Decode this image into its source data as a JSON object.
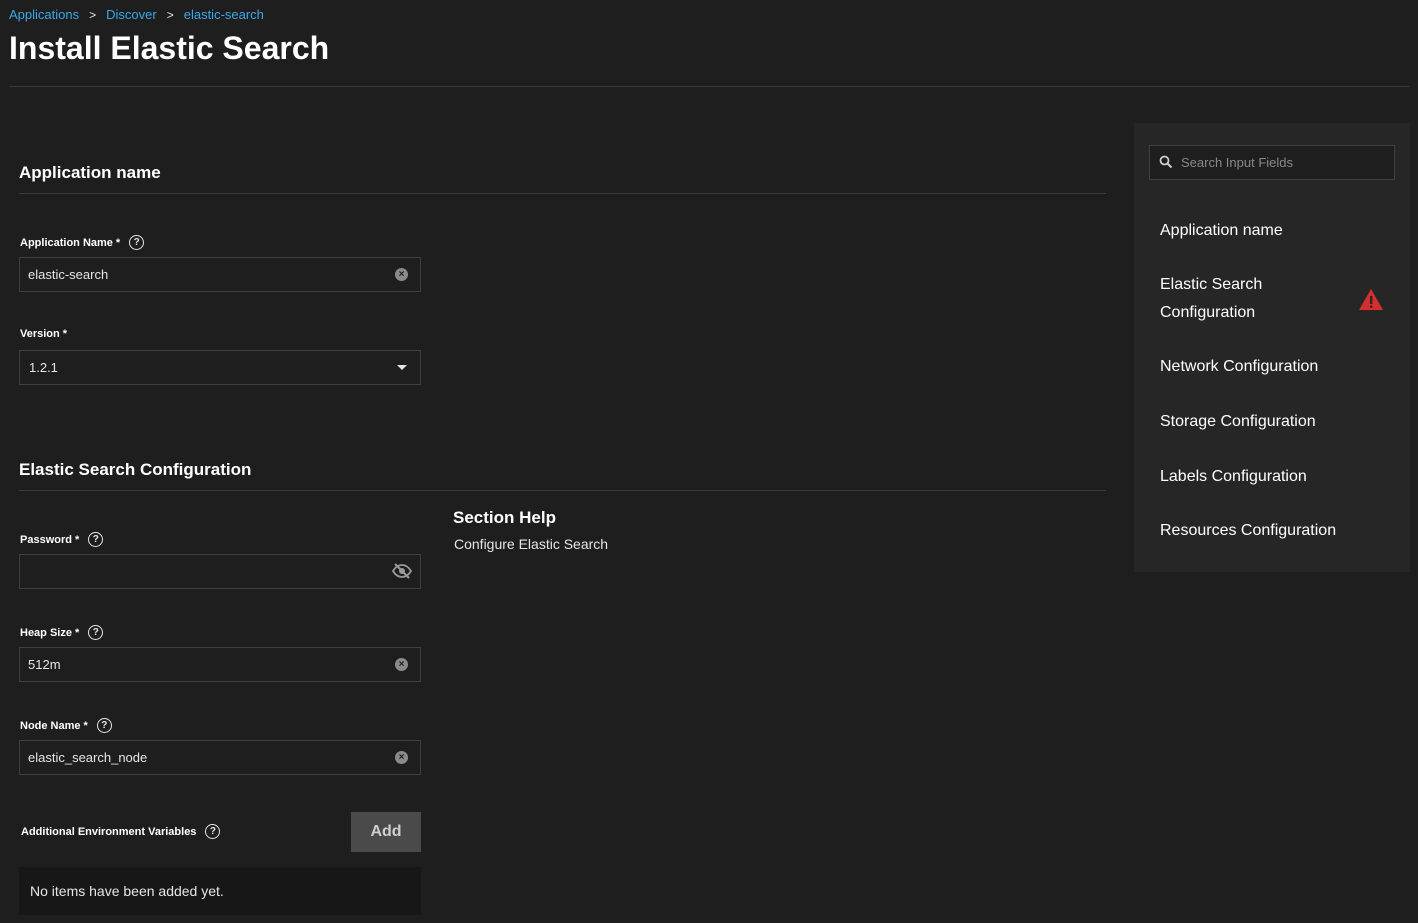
{
  "breadcrumb": {
    "items": [
      "Applications",
      "Discover",
      "elastic-search"
    ],
    "separator": ">"
  },
  "page": {
    "title": "Install Elastic Search"
  },
  "sections": {
    "app_name": {
      "title": "Application name",
      "app_name_label": "Application Name",
      "app_name_value": "elastic-search",
      "version_label": "Version",
      "version_value": "1.2.1"
    },
    "es_config": {
      "title": "Elastic Search Configuration",
      "password_label": "Password",
      "password_value": "",
      "heap_label": "Heap Size",
      "heap_value": "512m",
      "node_label": "Node Name",
      "node_value": "elastic_search_node",
      "env_label": "Additional Environment Variables",
      "add_label": "Add",
      "empty_text": "No items have been added yet."
    }
  },
  "required_marker": "*",
  "help_glyph": "?",
  "section_help": {
    "title": "Section Help",
    "text": "Configure Elastic Search"
  },
  "sidebar": {
    "search_placeholder": "Search Input Fields",
    "items": [
      {
        "label": "Application name"
      },
      {
        "label": "Elastic Search Configuration",
        "warning": true
      },
      {
        "label": "Network Configuration"
      },
      {
        "label": "Storage Configuration"
      },
      {
        "label": "Labels Configuration"
      },
      {
        "label": "Resources Configuration"
      }
    ]
  },
  "colors": {
    "accent": "#3ba7e8",
    "background": "#1e1e1e",
    "panel": "#262626",
    "warning": "#d32f2f"
  },
  "icons": [
    "help-icon",
    "clear-icon",
    "chevron-down-icon",
    "eye-off-icon",
    "search-icon",
    "warning-icon"
  ]
}
